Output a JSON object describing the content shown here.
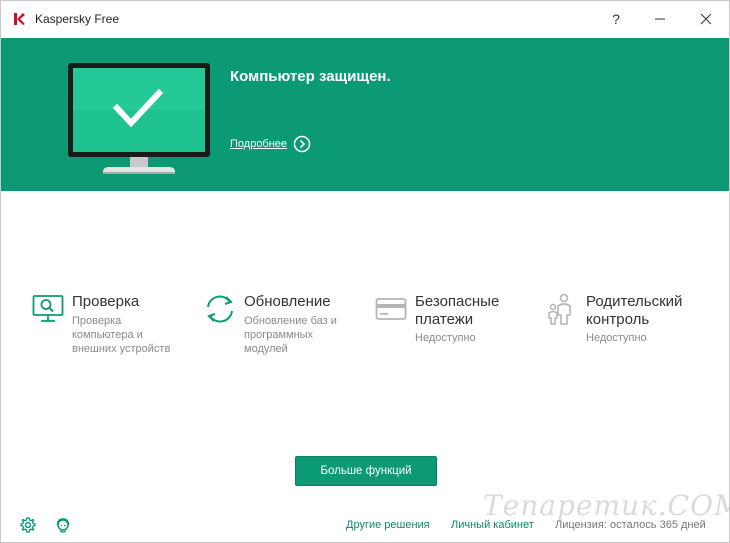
{
  "window": {
    "title": "Kaspersky Free",
    "help_label": "?"
  },
  "colors": {
    "accent": "#0b9a74",
    "brand_red": "#c8102e",
    "text_dark": "#333333",
    "text_muted": "#8a8a8a",
    "link": "#0b8a6a"
  },
  "banner": {
    "status": "Компьютер защищен.",
    "details_link": "Подробнее",
    "monitor_icon": "monitor-check-icon",
    "arrow_icon": "circle-chevron-right-icon"
  },
  "features": [
    {
      "icon": "scan-monitor-icon",
      "title_lines": [
        "Проверка"
      ],
      "desc_lines": [
        "Проверка",
        "компьютера и",
        "внешних устройств"
      ],
      "enabled": true
    },
    {
      "icon": "update-arrows-icon",
      "title_lines": [
        "Обновление"
      ],
      "desc_lines": [
        "Обновление баз и",
        "программных",
        "модулей"
      ],
      "enabled": true
    },
    {
      "icon": "credit-card-icon",
      "title_lines": [
        "Безопасные",
        "платежи"
      ],
      "desc_lines": [
        "Недоступно"
      ],
      "enabled": false
    },
    {
      "icon": "family-icon",
      "title_lines": [
        "Родительский",
        "контроль"
      ],
      "desc_lines": [
        "Недоступно"
      ],
      "enabled": false
    }
  ],
  "more_button": "Больше функций",
  "footer": {
    "settings_icon": "gear-icon",
    "support_icon": "support-agent-icon",
    "other_solutions": "Другие решения",
    "my_account": "Личный кабинет",
    "license": "Лицензия: осталось 365 дней"
  },
  "watermark": "Тепаретик.COM"
}
